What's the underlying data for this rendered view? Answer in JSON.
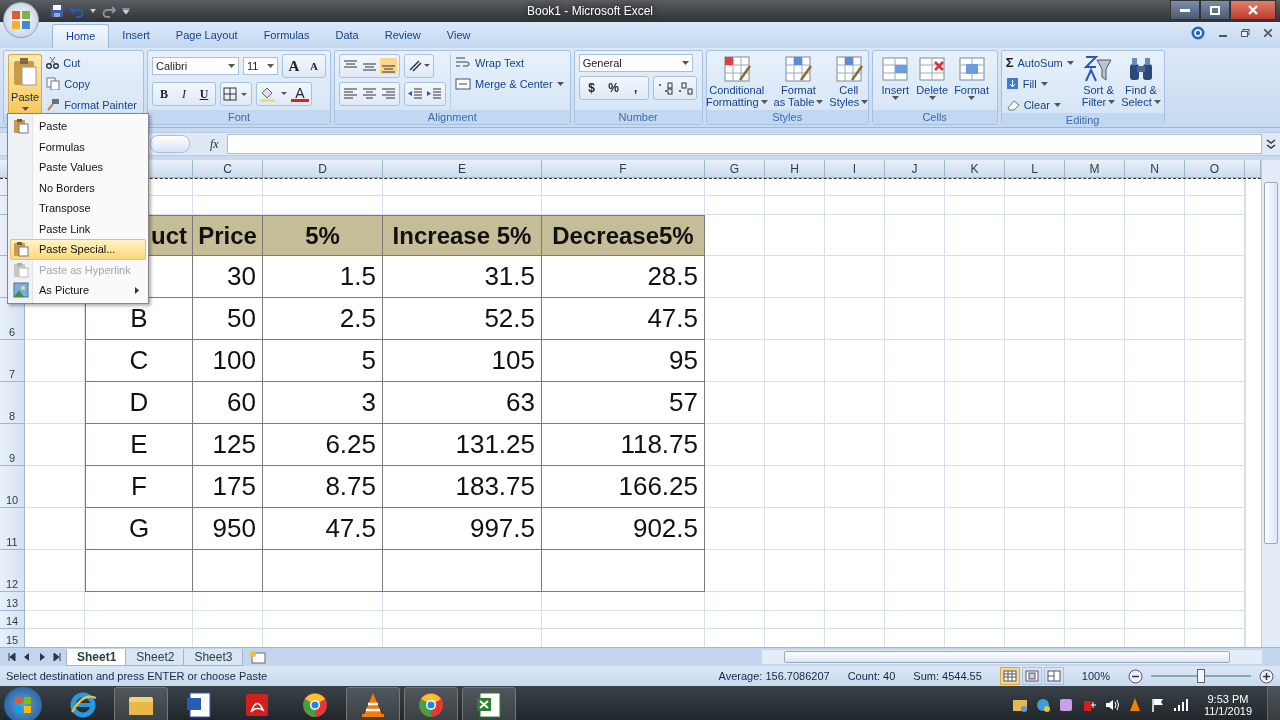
{
  "window": {
    "title": "Book1 - Microsoft Excel"
  },
  "tabs": [
    {
      "label": "Home",
      "selected": true
    },
    {
      "label": "Insert",
      "selected": false
    },
    {
      "label": "Page Layout",
      "selected": false
    },
    {
      "label": "Formulas",
      "selected": false
    },
    {
      "label": "Data",
      "selected": false
    },
    {
      "label": "Review",
      "selected": false
    },
    {
      "label": "View",
      "selected": false
    }
  ],
  "clipboard": {
    "paste": "Paste",
    "cut": "Cut",
    "copy": "Copy",
    "format_painter": "Format Painter"
  },
  "font": {
    "label": "Font",
    "name": "Calibri",
    "size": "11",
    "grow": "A",
    "shrink": "A",
    "bold": "B",
    "italic": "I",
    "underline": "U",
    "color_letter": "A"
  },
  "alignment": {
    "label": "Alignment",
    "wrap_text": "Wrap Text",
    "merge_center": "Merge & Center"
  },
  "number": {
    "label": "Number",
    "format": "General",
    "currency": "$",
    "percent": "%",
    "comma": ","
  },
  "styles": {
    "label": "Styles",
    "buttons": [
      {
        "line1": "Conditional",
        "line2": "Formatting"
      },
      {
        "line1": "Format",
        "line2": "as Table"
      },
      {
        "line1": "Cell",
        "line2": "Styles"
      }
    ]
  },
  "cells": {
    "label": "Cells",
    "buttons": [
      "Insert",
      "Delete",
      "Format"
    ]
  },
  "editing": {
    "label": "Editing",
    "sigma": "Σ",
    "autosum": "AutoSum",
    "fill": "Fill",
    "clear": "Clear",
    "sort": {
      "line1": "Sort &",
      "line2": "Filter"
    },
    "find": {
      "line1": "Find &",
      "line2": "Select"
    }
  },
  "paste_menu": [
    {
      "label": "Paste",
      "kind": "clipboard",
      "selected": false,
      "disabled": false,
      "submenu": false
    },
    {
      "label": "Formulas",
      "kind": "text",
      "selected": false,
      "disabled": false,
      "submenu": false
    },
    {
      "label": "Paste Values",
      "kind": "text",
      "selected": false,
      "disabled": false,
      "submenu": false
    },
    {
      "label": "No Borders",
      "kind": "text",
      "selected": false,
      "disabled": false,
      "submenu": false
    },
    {
      "label": "Transpose",
      "kind": "text",
      "selected": false,
      "disabled": false,
      "submenu": false
    },
    {
      "label": "Paste Link",
      "kind": "text",
      "selected": false,
      "disabled": false,
      "submenu": false
    },
    {
      "label": "Paste Special...",
      "kind": "clipboard",
      "selected": true,
      "disabled": false,
      "submenu": false
    },
    {
      "label": "Paste as Hyperlink",
      "kind": "clipboard",
      "selected": false,
      "disabled": true,
      "submenu": false
    },
    {
      "label": "As Picture",
      "kind": "picture",
      "selected": false,
      "disabled": false,
      "submenu": true
    }
  ],
  "formula_bar": {
    "fx": "fx"
  },
  "sheet": {
    "columns": [
      "C",
      "D",
      "E",
      "F",
      "G",
      "H",
      "I",
      "J",
      "K",
      "L",
      "M",
      "N",
      "O"
    ],
    "rows": [
      {
        "kind": "header",
        "cells": [
          "uct",
          "Price",
          "5%",
          "Increase 5%",
          "Decrease5%"
        ]
      },
      {
        "kind": "data",
        "cells": [
          null,
          "30",
          "1.5",
          "31.5",
          "28.5"
        ]
      },
      {
        "kind": "data",
        "number": "6",
        "cells": [
          "B",
          "50",
          "2.5",
          "52.5",
          "47.5"
        ]
      },
      {
        "kind": "data",
        "number": "7",
        "cells": [
          "C",
          "100",
          "5",
          "105",
          "95"
        ]
      },
      {
        "kind": "data",
        "number": "8",
        "cells": [
          "D",
          "60",
          "3",
          "63",
          "57"
        ]
      },
      {
        "kind": "data",
        "number": "9",
        "cells": [
          "E",
          "125",
          "6.25",
          "131.25",
          "118.75"
        ]
      },
      {
        "kind": "data",
        "number": "10",
        "cells": [
          "F",
          "175",
          "8.75",
          "183.75",
          "166.25"
        ]
      },
      {
        "kind": "data",
        "number": "11",
        "cells": [
          "G",
          "950",
          "47.5",
          "997.5",
          "902.5"
        ]
      },
      {
        "kind": "table_blank",
        "number": "12"
      },
      {
        "kind": "blank",
        "number": "13"
      },
      {
        "kind": "blank",
        "number": "14"
      },
      {
        "kind": "blank",
        "number": "15"
      }
    ]
  },
  "sheet_tabs": [
    {
      "label": "Sheet1",
      "selected": true
    },
    {
      "label": "Sheet2",
      "selected": false
    },
    {
      "label": "Sheet3",
      "selected": false
    }
  ],
  "status_bar": {
    "message": "Select destination and press ENTER or choose Paste",
    "average": "Average: 156.7086207",
    "count": "Count: 40",
    "sum": "Sum: 4544.55",
    "views": [
      {
        "selected": true
      },
      {
        "selected": false
      },
      {
        "selected": false
      }
    ],
    "zoom": "100%",
    "zoom_slider": {
      "level": 0.5
    }
  },
  "taskbar": {
    "apps": [
      {
        "kind": "browser_e",
        "running": false
      },
      {
        "kind": "folder",
        "running": true
      },
      {
        "kind": "document",
        "running": false
      },
      {
        "kind": "pdf",
        "running": false
      },
      {
        "kind": "wheel",
        "running": false
      },
      {
        "kind": "cone",
        "running": true
      },
      {
        "kind": "wheel",
        "running": true
      },
      {
        "kind": "spreadsheet",
        "running": true
      }
    ],
    "time": "9:53 PM",
    "date": "11/1/2019"
  }
}
